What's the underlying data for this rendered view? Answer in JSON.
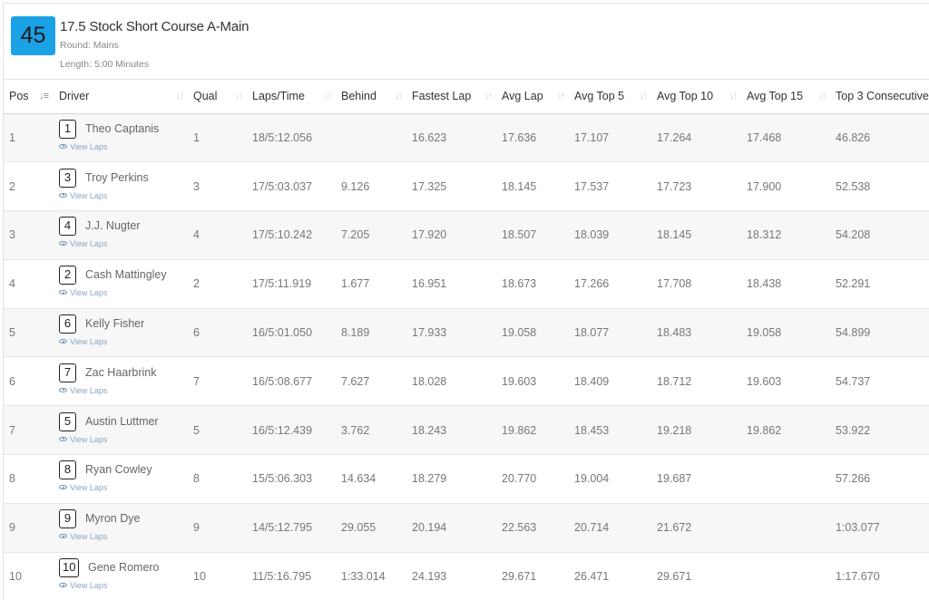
{
  "header": {
    "heat_number": "45",
    "title": "17.5 Stock Short Course A-Main",
    "round": "Round: Mains",
    "length": "Length: 5:00 Minutes"
  },
  "table": {
    "view_laps_label": "View Laps",
    "columns": [
      "Pos",
      "Driver",
      "Qual",
      "Laps/Time",
      "Behind",
      "Fastest Lap",
      "Avg Lap",
      "Avg Top 5",
      "Avg Top 10",
      "Avg Top 15",
      "Top 3 Consecutive"
    ],
    "rows": [
      {
        "pos": "1",
        "car": "1",
        "driver": "Theo Captanis",
        "qual": "1",
        "laps_time": "18/5:12.056",
        "behind": "",
        "fastest": "16.623",
        "avg_lap": "17.636",
        "top5": "17.107",
        "top10": "17.264",
        "top15": "17.468",
        "top3c": "46.826"
      },
      {
        "pos": "2",
        "car": "3",
        "driver": "Troy Perkins",
        "qual": "3",
        "laps_time": "17/5:03.037",
        "behind": "9.126",
        "fastest": "17.325",
        "avg_lap": "18.145",
        "top5": "17.537",
        "top10": "17.723",
        "top15": "17.900",
        "top3c": "52.538"
      },
      {
        "pos": "3",
        "car": "4",
        "driver": "J.J. Nugter",
        "qual": "4",
        "laps_time": "17/5:10.242",
        "behind": "7.205",
        "fastest": "17.920",
        "avg_lap": "18.507",
        "top5": "18.039",
        "top10": "18.145",
        "top15": "18.312",
        "top3c": "54.208"
      },
      {
        "pos": "4",
        "car": "2",
        "driver": "Cash Mattingley",
        "qual": "2",
        "laps_time": "17/5:11.919",
        "behind": "1.677",
        "fastest": "16.951",
        "avg_lap": "18.673",
        "top5": "17.266",
        "top10": "17.708",
        "top15": "18.438",
        "top3c": "52.291"
      },
      {
        "pos": "5",
        "car": "6",
        "driver": "Kelly Fisher",
        "qual": "6",
        "laps_time": "16/5:01.050",
        "behind": "8.189",
        "fastest": "17.933",
        "avg_lap": "19.058",
        "top5": "18.077",
        "top10": "18.483",
        "top15": "19.058",
        "top3c": "54.899"
      },
      {
        "pos": "6",
        "car": "7",
        "driver": "Zac Haarbrink",
        "qual": "7",
        "laps_time": "16/5:08.677",
        "behind": "7.627",
        "fastest": "18.028",
        "avg_lap": "19.603",
        "top5": "18.409",
        "top10": "18.712",
        "top15": "19.603",
        "top3c": "54.737"
      },
      {
        "pos": "7",
        "car": "5",
        "driver": "Austin Luttmer",
        "qual": "5",
        "laps_time": "16/5:12.439",
        "behind": "3.762",
        "fastest": "18.243",
        "avg_lap": "19.862",
        "top5": "18.453",
        "top10": "19.218",
        "top15": "19.862",
        "top3c": "53.922"
      },
      {
        "pos": "8",
        "car": "8",
        "driver": "Ryan Cowley",
        "qual": "8",
        "laps_time": "15/5:06.303",
        "behind": "14.634",
        "fastest": "18.279",
        "avg_lap": "20.770",
        "top5": "19.004",
        "top10": "19.687",
        "top15": "",
        "top3c": "57.266"
      },
      {
        "pos": "9",
        "car": "9",
        "driver": "Myron Dye",
        "qual": "9",
        "laps_time": "14/5:12.795",
        "behind": "29.055",
        "fastest": "20.194",
        "avg_lap": "22.563",
        "top5": "20.714",
        "top10": "21.672",
        "top15": "",
        "top3c": "1:03.077"
      },
      {
        "pos": "10",
        "car": "10",
        "driver": "Gene Romero",
        "qual": "10",
        "laps_time": "11/5:16.795",
        "behind": "1:33.014",
        "fastest": "24.193",
        "avg_lap": "29.671",
        "top5": "26.471",
        "top10": "29.671",
        "top15": "",
        "top3c": "1:17.670"
      }
    ]
  }
}
